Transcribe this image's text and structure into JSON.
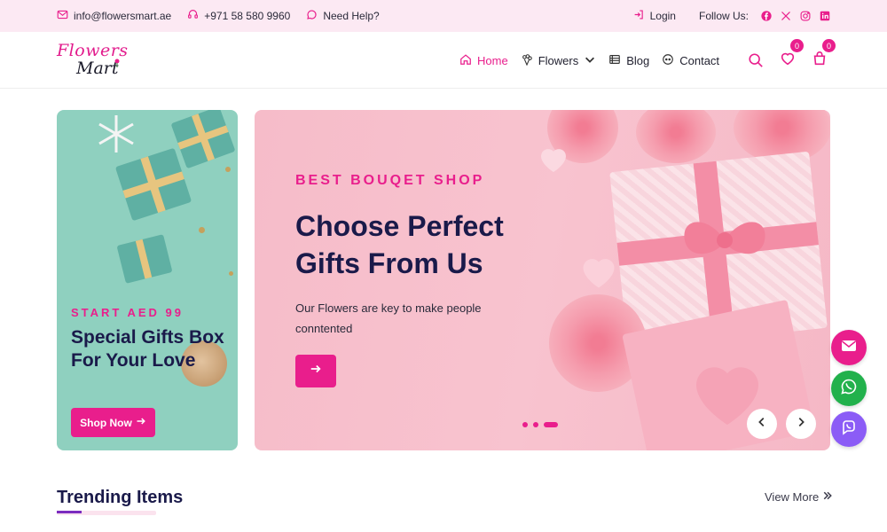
{
  "topbar": {
    "email": "info@flowersmart.ae",
    "phone": "+971 58 580 9960",
    "help": "Need Help?",
    "login": "Login",
    "follow": "Follow Us:"
  },
  "logo": {
    "line1": "Flowers",
    "line2": "Mart"
  },
  "nav": {
    "home": "Home",
    "flowers": "Flowers",
    "blog": "Blog",
    "contact": "Contact"
  },
  "header_icons": {
    "wishlist_count": "0",
    "cart_count": "0"
  },
  "promo": {
    "subtitle": "START AED 99",
    "title": "Special Gifts Box For Your Love",
    "button": "Shop Now"
  },
  "hero": {
    "subtitle": "BEST BOUQET SHOP",
    "title_line1": "Choose Perfect",
    "title_line2": "Gifts From Us",
    "description": "Our Flowers are key to make people conntented",
    "slide_count": 3,
    "active_slide": 3
  },
  "trending": {
    "title": "Trending Items",
    "view_more": "View More"
  },
  "colors": {
    "accent": "#e91e8c",
    "heading": "#1a1a4a",
    "topbar_bg": "#fce9f3",
    "promo_bg": "#8fd0bf",
    "hero_bg": "#f6bcc9",
    "whatsapp": "#22b14c",
    "viber": "#8b5cf6"
  },
  "icons": {
    "email": "envelope-icon",
    "phone": "headset-icon",
    "help": "chat-icon",
    "login": "login-icon",
    "social": [
      "facebook-icon",
      "x-icon",
      "instagram-icon",
      "linkedin-icon"
    ],
    "header": [
      "search-icon",
      "heart-icon",
      "bag-icon"
    ],
    "floating": [
      "envelope-icon",
      "whatsapp-icon",
      "viber-icon"
    ]
  }
}
